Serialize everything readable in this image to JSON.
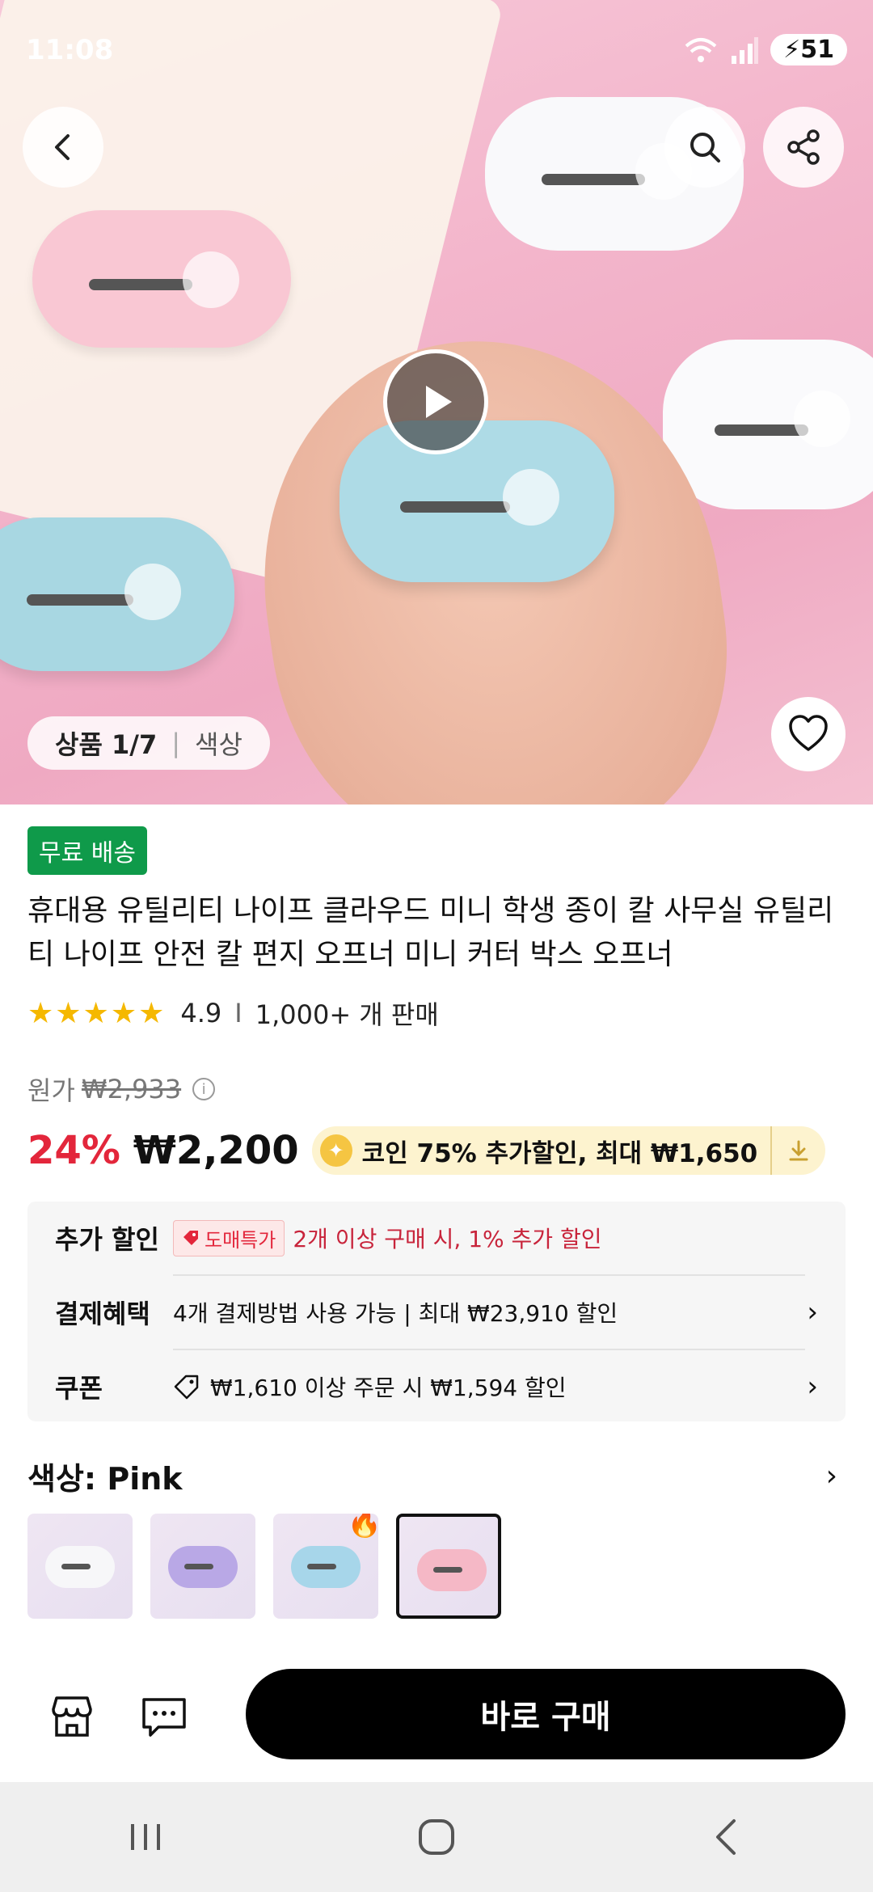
{
  "status_bar": {
    "time": "11:08",
    "battery": "51"
  },
  "hero": {
    "counter_label": "상품 1/7",
    "counter_divider": "|",
    "counter_tab": "색상"
  },
  "product": {
    "free_shipping": "무료 배송",
    "title": "휴대용 유틸리티 나이프 클라우드 미니 학생 종이 칼 사무실 유틸리티 나이프 안전 칼 편지 오프너 미니 커터 박스 오프너",
    "stars": "★★★★★",
    "rating": "4.9",
    "rating_sep": "I",
    "sold": "1,000+ 개 판매",
    "original_price_label": "원가",
    "original_price": "₩2,933",
    "discount": "24%",
    "price": "₩2,200",
    "coin_text": "코인 75% 추가할인, 최대 ₩1,650"
  },
  "benefits": {
    "row1_label": "추가 할인",
    "row1_tag": "도매특가",
    "row1_text": "2개 이상 구매 시, 1% 추가 할인",
    "row2_label": "결제혜택",
    "row2_text": "4개 결제방법 사용 가능 | 최대 ₩23,910 할인",
    "row3_label": "쿠폰",
    "row3_text": "₩1,610 이상 주문 시 ₩1,594 할인"
  },
  "variant": {
    "label": "색상: Pink",
    "swatches": [
      "white",
      "purple",
      "blue",
      "pink"
    ],
    "colors": {
      "white": "#f7f7f9",
      "purple": "#b9a8e6",
      "blue": "#a7d6ea",
      "pink": "#f5b8c6"
    }
  },
  "actions": {
    "buy_now": "바로 구매"
  },
  "colors": {
    "accent_red": "#e3263b",
    "free_ship_green": "#0f9a4a",
    "buy_btn": "#000000"
  }
}
